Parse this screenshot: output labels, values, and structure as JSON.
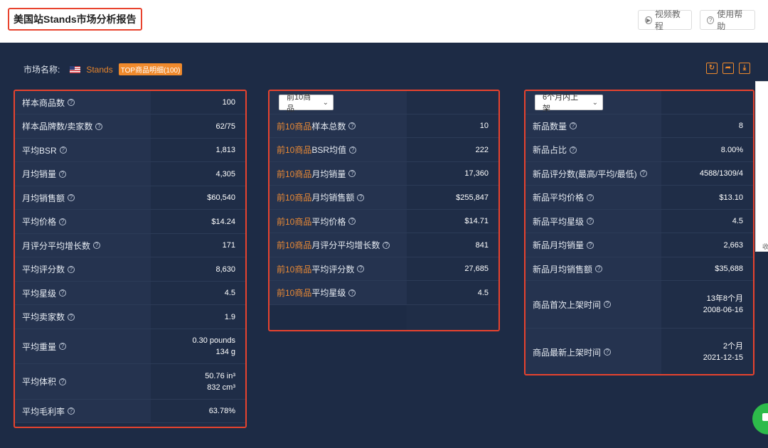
{
  "header": {
    "title": "美国站Stands市场分析报告",
    "video_label": "视频教程",
    "help_label": "使用帮助"
  },
  "market": {
    "label": "市场名称:",
    "name": "Stands",
    "tag": "TOP商品明细(100)"
  },
  "panel1": {
    "rows": [
      {
        "label": "样本商品数",
        "value": "100"
      },
      {
        "label": "样本品牌数/卖家数",
        "value": "62/75"
      },
      {
        "label": "平均BSR",
        "value": "1,813"
      },
      {
        "label": "月均销量",
        "value": "4,305"
      },
      {
        "label": "月均销售额",
        "value": "$60,540"
      },
      {
        "label": "平均价格",
        "value": "$14.24"
      },
      {
        "label": "月评分平均增长数",
        "value": "171"
      },
      {
        "label": "平均评分数",
        "value": "8,630"
      },
      {
        "label": "平均星级",
        "value": "4.5"
      },
      {
        "label": "平均卖家数",
        "value": "1.9"
      },
      {
        "label": "平均重量",
        "value": "0.30 pounds",
        "value2": "134 g"
      },
      {
        "label": "平均体积",
        "value": "50.76 in³",
        "value2": "832 cm³"
      },
      {
        "label": "平均毛利率",
        "value": "63.78%"
      }
    ]
  },
  "panel2": {
    "select": "前10商品",
    "prefix": "前10商品",
    "rows": [
      {
        "label": "样本总数",
        "value": "10"
      },
      {
        "label": "BSR均值",
        "value": "222"
      },
      {
        "label": "月均销量",
        "value": "17,360"
      },
      {
        "label": "月均销售额",
        "value": "$255,847"
      },
      {
        "label": "平均价格",
        "value": "$14.71"
      },
      {
        "label": "月评分平均增长数",
        "value": "841"
      },
      {
        "label": "平均评分数",
        "value": "27,685"
      },
      {
        "label": "平均星级",
        "value": "4.5"
      }
    ]
  },
  "panel3": {
    "select": "6个月内上架",
    "rows": [
      {
        "label": "新品数量",
        "value": "8"
      },
      {
        "label": "新品占比",
        "value": "8.00%"
      },
      {
        "label": "新品评分数(最高/平均/最低)",
        "value": "4588/1309/4"
      },
      {
        "label": "新品平均价格",
        "value": "$13.10"
      },
      {
        "label": "新品平均星级",
        "value": "4.5"
      },
      {
        "label": "新品月均销量",
        "value": "2,663"
      },
      {
        "label": "新品月均销售额",
        "value": "$35,688"
      },
      {
        "label": "商品首次上架时间",
        "value": "13年8个月",
        "value2": "2008-06-16"
      },
      {
        "label": "商品最新上架时间",
        "value": "2个月",
        "value2": "2021-12-15"
      }
    ]
  },
  "edge_chars": [
    "收"
  ]
}
